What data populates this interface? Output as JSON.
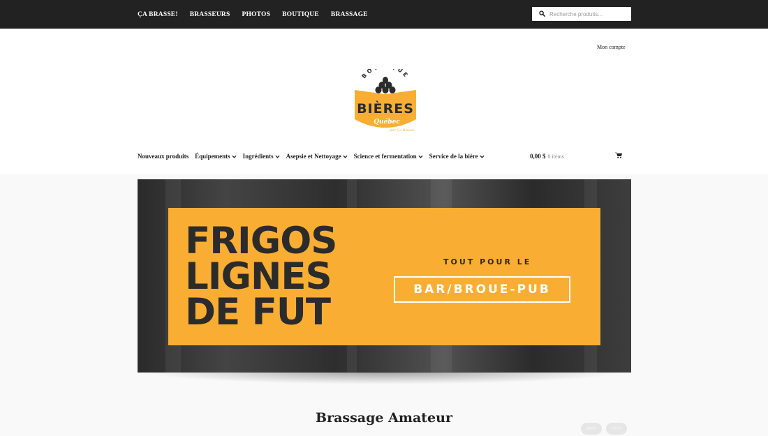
{
  "topnav": {
    "items": [
      "ÇA BRASSE!",
      "BRASSEURS",
      "PHOTOS",
      "BOUTIQUE",
      "BRASSAGE"
    ]
  },
  "search": {
    "placeholder": "Recherche produits..."
  },
  "account": {
    "label": "Mon compte"
  },
  "logo": {
    "arc_text": "BOUTIQUE",
    "main_text": "BIÈRES",
    "sub_text": "Québec",
    "signature": "par Ça Brasse"
  },
  "mainnav": {
    "items": [
      {
        "label": "Nouveaux produits",
        "dropdown": false
      },
      {
        "label": "Équipements",
        "dropdown": true
      },
      {
        "label": "Ingrédients",
        "dropdown": true
      },
      {
        "label": "Asepsie et Nettoyage",
        "dropdown": true
      },
      {
        "label": "Science et fermentation",
        "dropdown": true
      },
      {
        "label": "Service de la bière",
        "dropdown": true
      }
    ]
  },
  "cart": {
    "amount": "0,00 $",
    "count": "0 items"
  },
  "banner": {
    "headline": [
      "FRIGOS",
      "LIGNES",
      "DE FUT"
    ],
    "tagline": "TOUT POUR LE",
    "box_label": "BAR/BROUE-PUB"
  },
  "section": {
    "title": "Brassage Amateur"
  },
  "pager": {
    "prev": "prev",
    "next": "next"
  },
  "colors": {
    "accent": "#f9ae33",
    "topbar": "#222222",
    "text": "#222222"
  }
}
